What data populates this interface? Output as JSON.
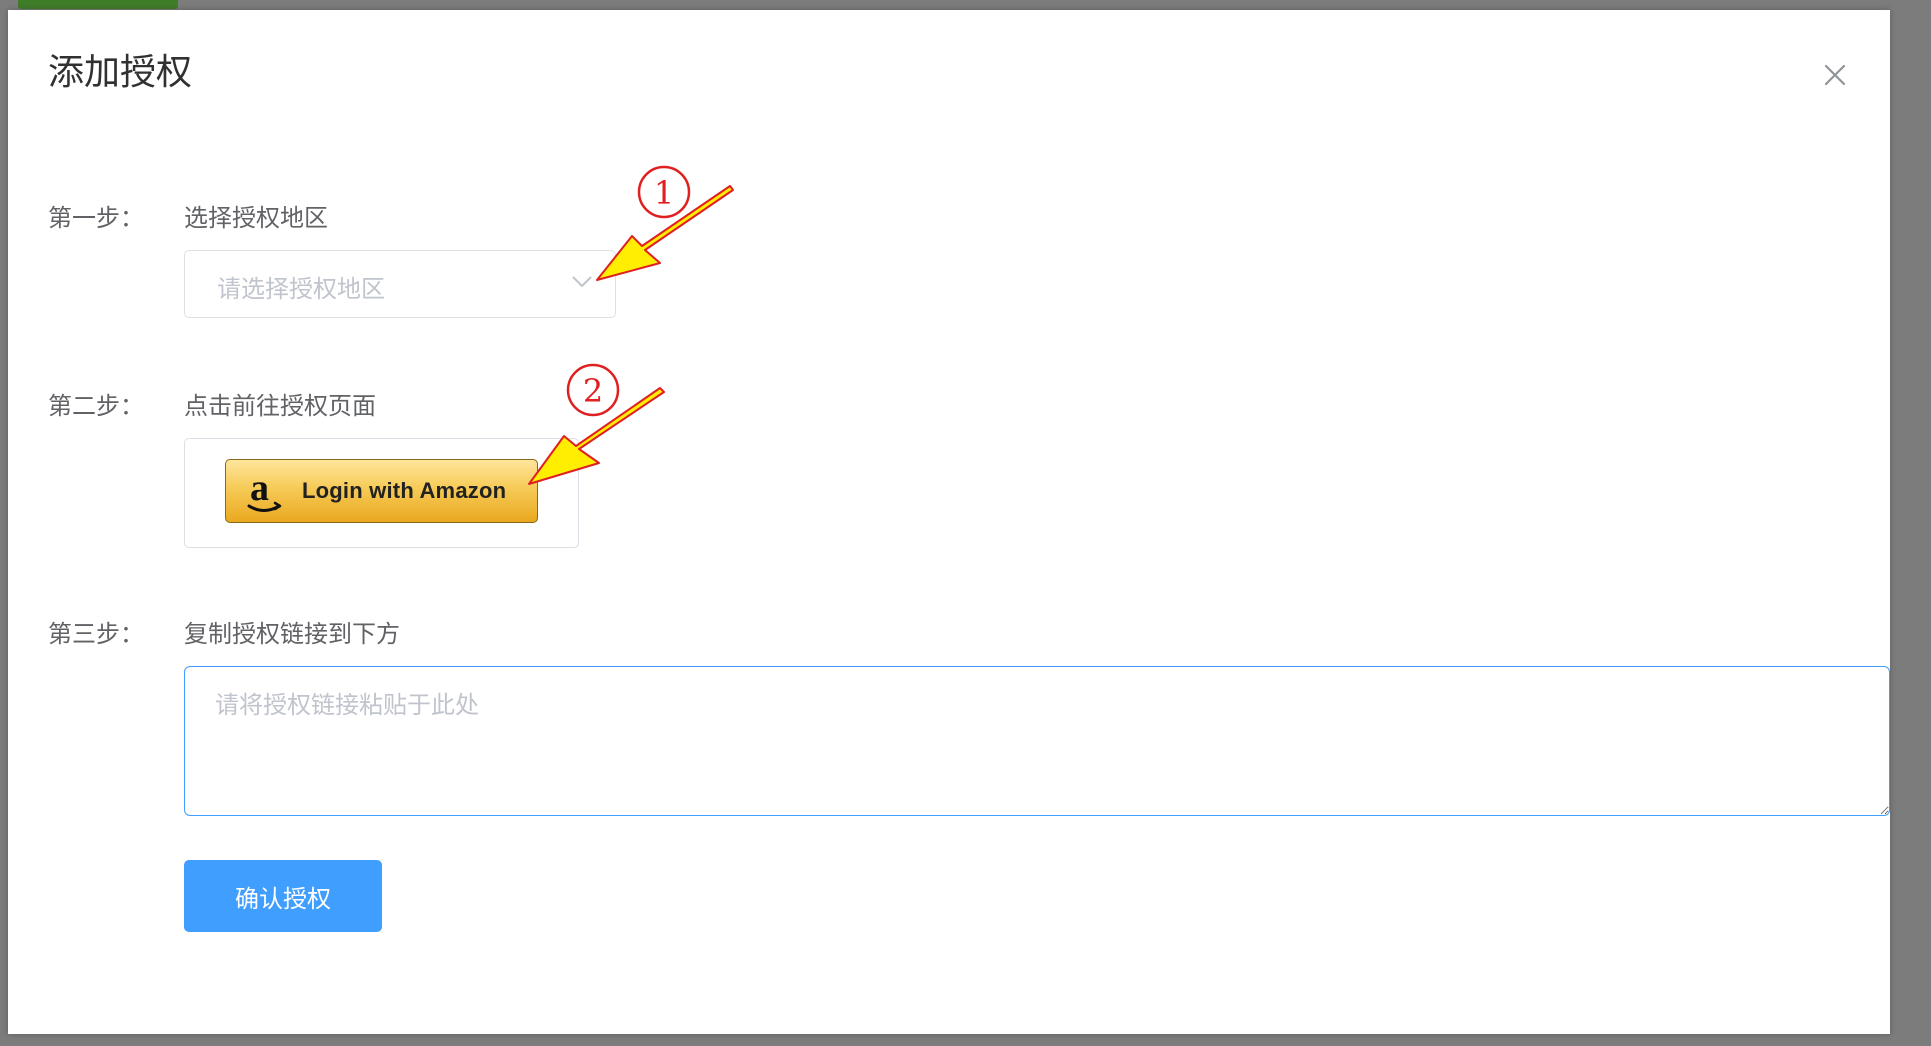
{
  "dialog": {
    "title": "添加授权",
    "close_icon": "close-icon"
  },
  "step1": {
    "label": "第一步：",
    "description": "选择授权地区",
    "select_placeholder": "请选择授权地区",
    "select_icon": "chevron-down-icon"
  },
  "step2": {
    "label": "第二步：",
    "description": "点击前往授权页面",
    "amazon_button_label": "Login with Amazon",
    "amazon_icon": "amazon-logo-icon"
  },
  "step3": {
    "label": "第三步：",
    "description": "复制授权链接到下方",
    "textarea_placeholder": "请将授权链接粘贴于此处",
    "textarea_value": ""
  },
  "confirm_button_label": "确认授权",
  "annotations": [
    {
      "number": "1"
    },
    {
      "number": "2"
    }
  ],
  "colors": {
    "primary": "#409eff",
    "annotation_red": "#e02020",
    "annotation_arrow_fill": "#ffee00",
    "amazon_gold": "#f6cb57"
  }
}
